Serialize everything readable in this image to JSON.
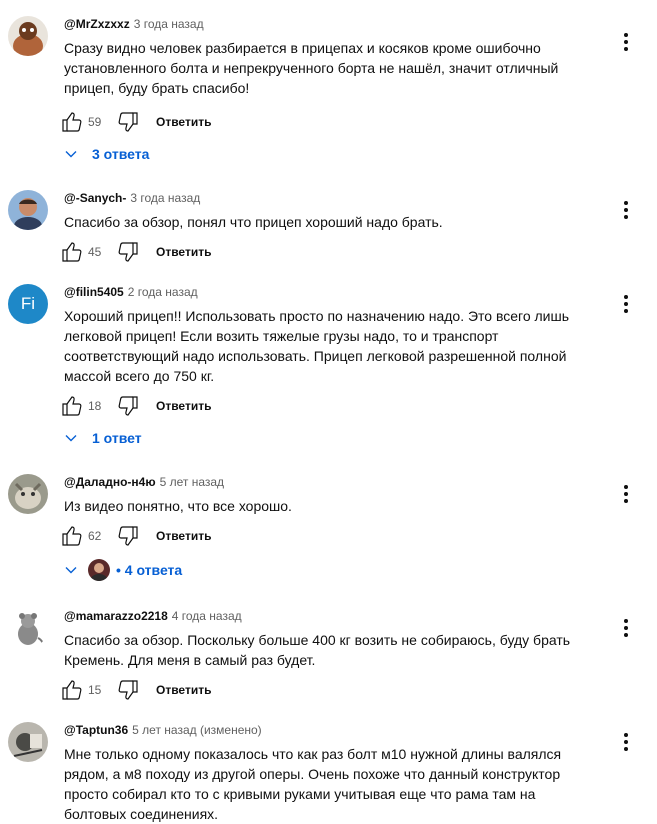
{
  "comments": [
    {
      "author": "@MrZxzxxz",
      "time": "3 года назад",
      "text": "Сразу видно человек разбирается в прицепах и косяков кроме ошибочно\nустановленного болта и непрекрученного  борта не нашёл, значит отличный\nприцеп, буду брать спасибо!",
      "likes": "59",
      "reply_label": "Ответить",
      "replies_label": "3 ответа"
    },
    {
      "author": "@-Sanych-",
      "time": "3 года назад",
      "text": "Спасибо за обзор,  понял что прицеп хороший надо брать.",
      "likes": "45",
      "reply_label": "Ответить"
    },
    {
      "author": "@filin5405",
      "avatar_letter": "Fi",
      "time": "2 года назад",
      "text": "Хороший прицеп!! Использовать просто по назначению надо.  Это всего лишь\nлегковой прицеп!  Если возить  тяжелые грузы надо, то и транспорт\nсоответствующий надо использовать. Прицеп легковой  разрешенной  полной\nмассой всего до 750 кг.",
      "likes": "18",
      "reply_label": "Ответить",
      "replies_label": "1 ответ"
    },
    {
      "author": "@Даладно-н4ю",
      "time": "5 лет назад",
      "text": "Из видео понятно, что все хорошо.",
      "likes": "62",
      "reply_label": "Ответить",
      "replies_label": "• 4 ответа"
    },
    {
      "author": "@mamarazzo2218",
      "time": "4 года назад",
      "text": "Спасибо за обзор. Поскольку больше 400 кг возить не собираюсь, буду брать\nКремень. Для меня в самый раз будет.",
      "likes": "15",
      "reply_label": "Ответить"
    },
    {
      "author": "@Taptun36",
      "time": "5 лет назад (изменено)",
      "text": "Мне только одному показалось что как раз болт м10 нужной длины валялся\nрядом, а м8 походу из другой оперы. Очень похоже что данный конструктор\nпросто собирал кто то с кривыми руками учитывая еще что рама там на\nболтовых соединениях."
    }
  ],
  "colors": {
    "link_blue": "#065fd4",
    "secondary_text": "#606060",
    "avatar_fi_bg": "#1e88c8"
  },
  "icons": [
    "like-icon",
    "dislike-icon",
    "more-vert-icon",
    "chevron-down-icon"
  ]
}
